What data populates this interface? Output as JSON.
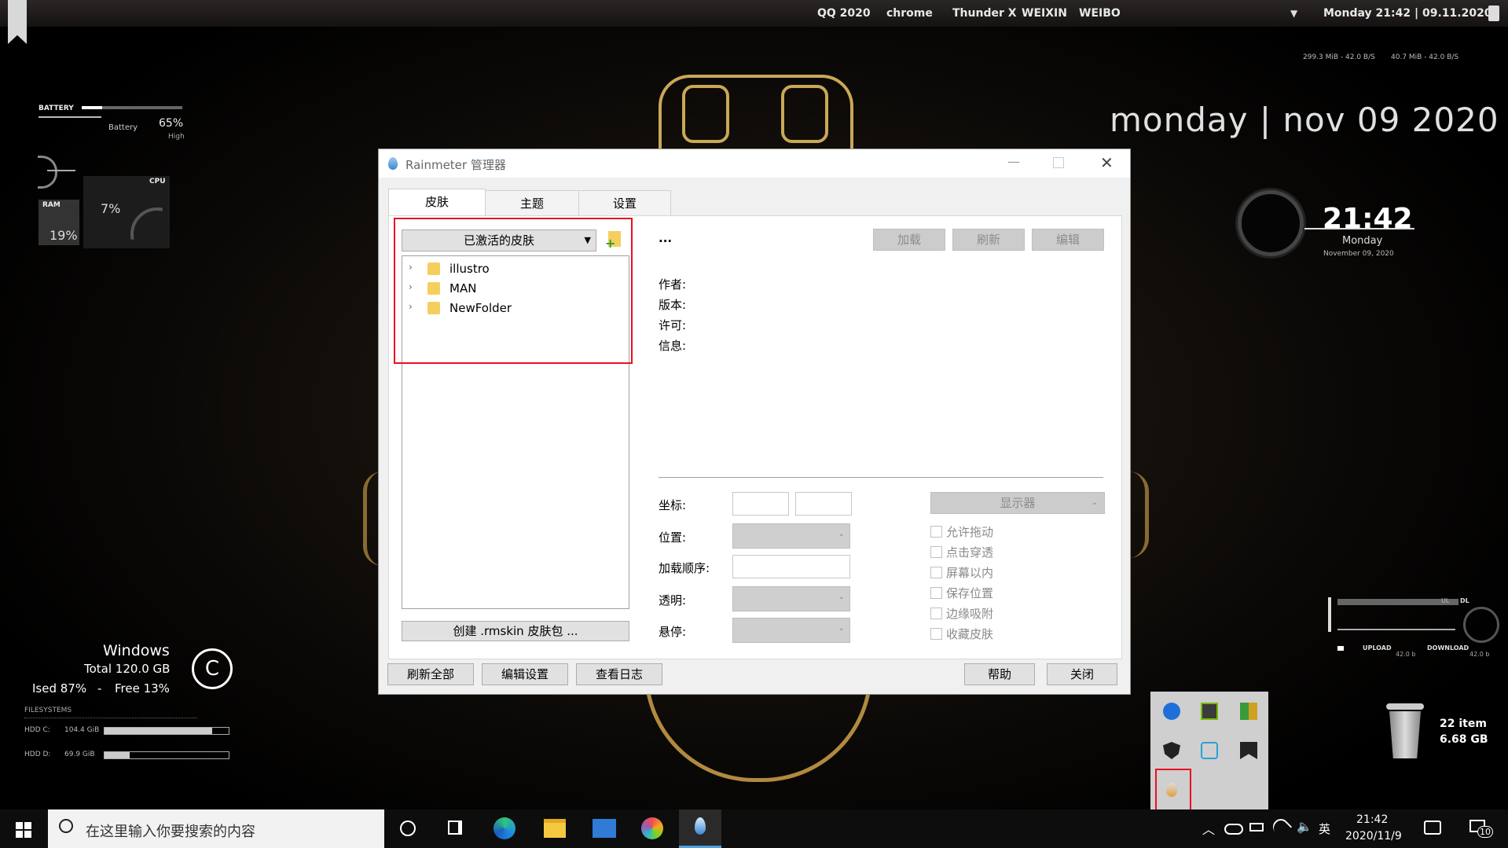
{
  "topbar": {
    "links": [
      "QQ 2020",
      "chrome",
      "Thunder X",
      "WEIXIN",
      "WEIBO"
    ],
    "datetime": "Monday 21:42 | 09.11.2020",
    "net_left": "299.3 MiB - 42.0 B/S",
    "net_right": "40.7 MiB - 42.0 B/S"
  },
  "desktop": {
    "date_big": "monday | nov 09 2020",
    "clock": {
      "time": "21:42",
      "day": "Monday",
      "date": "November 09, 2020"
    },
    "battery": {
      "title": "BATTERY",
      "label": "Battery",
      "value": "65%",
      "level": "High"
    },
    "cpu_ram": {
      "cpu": "CPU",
      "ram": "RAM",
      "cpu_pct": "7%",
      "ram_pct": "19%"
    },
    "drive": {
      "name": "Windows",
      "total": "Total 120.0 GB",
      "used": "Ised 87%",
      "sep": "-",
      "free": "Free 13%",
      "icon_letter": "C"
    },
    "filesystems": {
      "title": "FILESYSTEMS",
      "rows": [
        {
          "name": "HDD C:",
          "size": "104.4 GiB",
          "fill": 0.87
        },
        {
          "name": "HDD D:",
          "size": "69.9 GiB",
          "fill": 0.2
        }
      ]
    },
    "netgraph": {
      "upload": "UPLOAD",
      "download": "DOWNLOAD",
      "up_val": "42.0 b",
      "dl_val": "42.0 b",
      "ul": "UL",
      "dl": "DL"
    },
    "recycle": {
      "items": "22 item",
      "size": "6.68 GB"
    }
  },
  "window": {
    "title": "Rainmeter 管理器",
    "tabs": [
      "皮肤",
      "主题",
      "设置"
    ],
    "dropdown": "已激活的皮肤",
    "tree": [
      "illustro",
      "MAN",
      "NewFolder"
    ],
    "skin_name": "...",
    "action_buttons": [
      "加载",
      "刷新",
      "编辑"
    ],
    "info_labels": [
      "作者:",
      "版本:",
      "许可:",
      "信息:"
    ],
    "settings_labels": [
      "坐标:",
      "位置:",
      "加载顺序:",
      "透明:",
      "悬停:"
    ],
    "display_select": "显示器",
    "checkboxes": [
      "允许拖动",
      "点击穿透",
      "屏幕以内",
      "保存位置",
      "边缘吸附",
      "收藏皮肤"
    ],
    "create_pkg": "创建 .rmskin 皮肤包 ...",
    "bottom_left": [
      "刷新全部",
      "编辑设置",
      "查看日志"
    ],
    "bottom_right": [
      "帮助",
      "关闭"
    ]
  },
  "taskbar": {
    "search_placeholder": "在这里输入你要搜索的内容",
    "time": "21:42",
    "date": "2020/11/9",
    "ime": "英",
    "notifications": "10"
  },
  "colors": {
    "accent": "#e81123",
    "gold": "#c9a855",
    "window_bg": "#f0f0f0"
  }
}
